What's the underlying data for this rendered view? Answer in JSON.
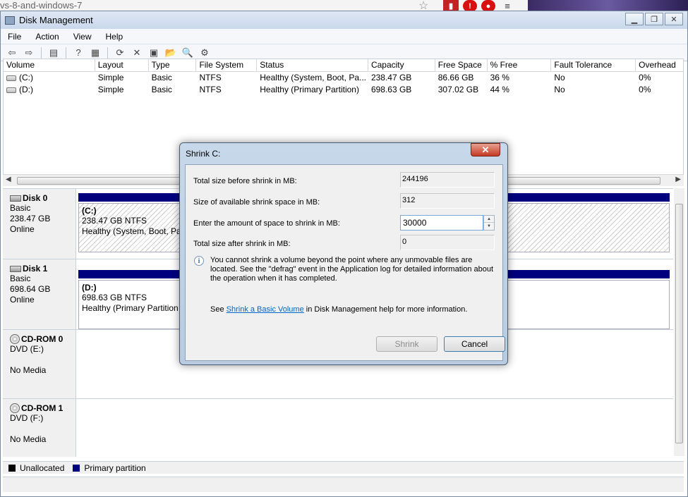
{
  "browser": {
    "url_fragment": "vs-8-and-windows-7",
    "star_icon": "star-icon",
    "addon_icons": [
      "addon-icon",
      "stop-icon",
      "stop-icon",
      "menu-icon"
    ]
  },
  "window": {
    "title": "Disk Management",
    "controls": [
      "minimize-icon",
      "restore-icon",
      "close-icon"
    ]
  },
  "menu": {
    "items": [
      "File",
      "Action",
      "View",
      "Help"
    ]
  },
  "toolbar": {
    "icons": [
      "back-icon",
      "forward-icon",
      "view-icon",
      "help-icon",
      "properties-icon",
      "refresh-icon",
      "delete-icon",
      "properties-icon",
      "open-icon",
      "explore-icon",
      "settings-icon"
    ]
  },
  "volume_table": {
    "columns": [
      "Volume",
      "Layout",
      "Type",
      "File System",
      "Status",
      "Capacity",
      "Free Space",
      "% Free",
      "Fault Tolerance",
      "Overhead"
    ],
    "rows": [
      [
        "(C:)",
        "Simple",
        "Basic",
        "NTFS",
        "Healthy (System, Boot, Pa...",
        "238.47 GB",
        "86.66 GB",
        "36 %",
        "No",
        "0%"
      ],
      [
        "(D:)",
        "Simple",
        "Basic",
        "NTFS",
        "Healthy (Primary Partition)",
        "698.63 GB",
        "307.02 GB",
        "44 %",
        "No",
        "0%"
      ]
    ]
  },
  "disks": [
    {
      "name": "Disk 0",
      "type": "Basic",
      "size": "238.47 GB",
      "state": "Online",
      "part_title": "(C:)",
      "part_size": "238.47 GB NTFS",
      "part_status": "Healthy (System, Boot, Pa"
    },
    {
      "name": "Disk 1",
      "type": "Basic",
      "size": "698.64 GB",
      "state": "Online",
      "part_title": "(D:)",
      "part_size": "698.63 GB NTFS",
      "part_status": "Healthy (Primary Partition"
    },
    {
      "name": "CD-ROM 0",
      "type": "DVD (E:)",
      "media": "No Media"
    },
    {
      "name": "CD-ROM 1",
      "type": "DVD (F:)",
      "media": "No Media"
    }
  ],
  "legend": {
    "unallocated": "Unallocated",
    "unallocated_color": "#000000",
    "primary": "Primary partition",
    "primary_color": "#00007f"
  },
  "dialog": {
    "title": "Shrink C:",
    "total_before_label": "Total size before shrink in MB:",
    "total_before_value": "244196",
    "available_label": "Size of available shrink space in MB:",
    "available_value": "312",
    "amount_label": "Enter the amount of space to shrink in MB:",
    "amount_value": "30000",
    "total_after_label": "Total size after shrink in MB:",
    "total_after_value": "0",
    "info_text": "You cannot shrink a volume beyond the point where any unmovable files are located. See the \"defrag\" event in the Application log for detailed information about the operation when it has completed.",
    "see_prefix": "See ",
    "help_link": "Shrink a Basic Volume",
    "see_suffix": " in Disk Management help for more information.",
    "shrink_button": "Shrink",
    "cancel_button": "Cancel"
  }
}
